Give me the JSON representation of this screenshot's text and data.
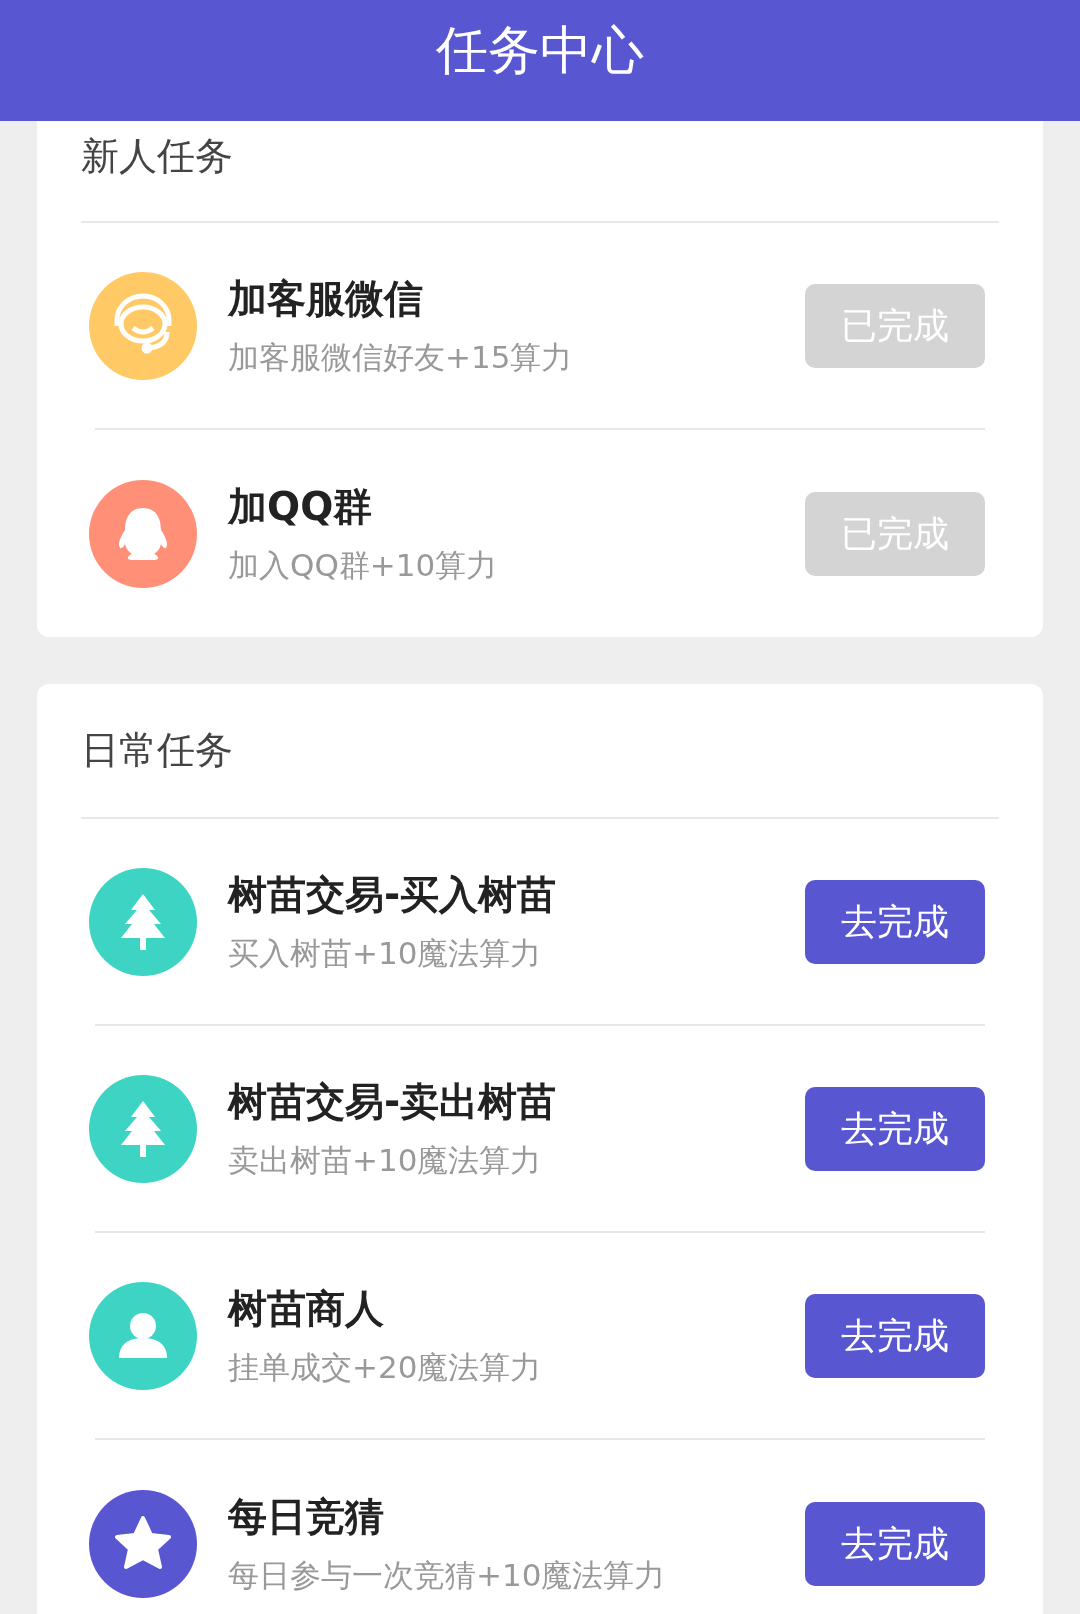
{
  "header": {
    "title": "任务中心"
  },
  "sections": [
    {
      "title": "新人任务",
      "tasks": [
        {
          "kind": "headset",
          "color": "#ffc966",
          "title": "加客服微信",
          "subtitle": "加客服微信好友+15算力",
          "button": "已完成",
          "done": true
        },
        {
          "kind": "penguin",
          "color": "#ff8f77",
          "title": "加QQ群",
          "subtitle": "加入QQ群+10算力",
          "button": "已完成",
          "done": true
        }
      ]
    },
    {
      "title": "日常任务",
      "tasks": [
        {
          "kind": "tree",
          "color": "#3ed4c4",
          "title": "树苗交易-买入树苗",
          "subtitle": "买入树苗+10魔法算力",
          "button": "去完成",
          "done": false
        },
        {
          "kind": "tree",
          "color": "#3ed4c4",
          "title": "树苗交易-卖出树苗",
          "subtitle": "卖出树苗+10魔法算力",
          "button": "去完成",
          "done": false
        },
        {
          "kind": "person",
          "color": "#3ed4c4",
          "title": "树苗商人",
          "subtitle": "挂单成交+20魔法算力",
          "button": "去完成",
          "done": false
        },
        {
          "kind": "star",
          "color": "#5856d0",
          "title": "每日竞猜",
          "subtitle": "每日参与一次竞猜+10魔法算力",
          "button": "去完成",
          "done": false
        }
      ]
    }
  ]
}
